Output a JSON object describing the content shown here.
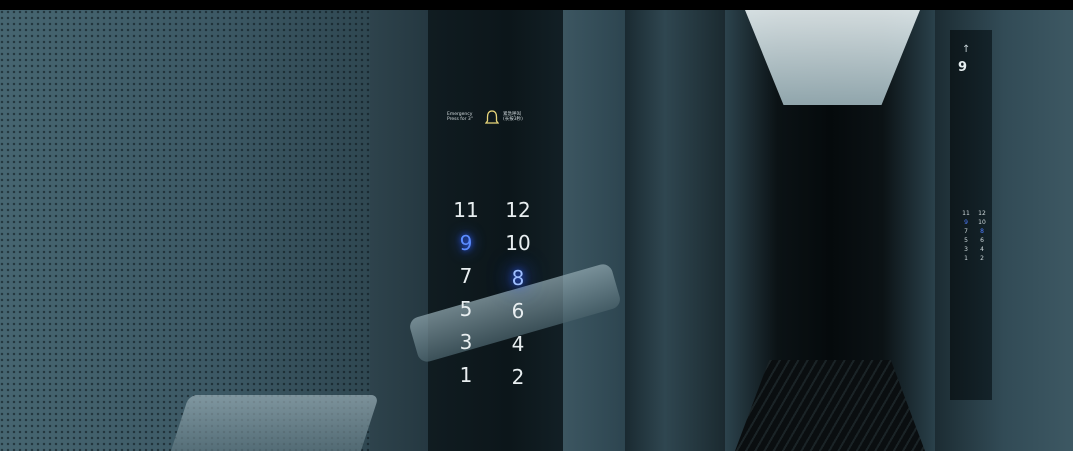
{
  "emergency": {
    "label_en_1": "Emergency",
    "label_en_2": "Press for 3\"",
    "label_cn_1": "紧急呼叫",
    "label_cn_2": "(长按3秒)",
    "icon": "bell-icon"
  },
  "keypad": {
    "left_column": [
      "11",
      "9",
      "7",
      "5",
      "3",
      "1"
    ],
    "right_column": [
      "12",
      "10",
      "8",
      "6",
      "4",
      "2"
    ],
    "lit_buttons": [
      "9",
      "8"
    ],
    "lit_color": "#5b8cff"
  },
  "mirror_panel": {
    "arrow": "↑",
    "floor_indicator": "9",
    "buttons": [
      "11",
      "12",
      "9",
      "10",
      "7",
      "8",
      "5",
      "6",
      "3",
      "4",
      "1",
      "2"
    ],
    "lit_buttons": [
      "9",
      "8"
    ]
  }
}
